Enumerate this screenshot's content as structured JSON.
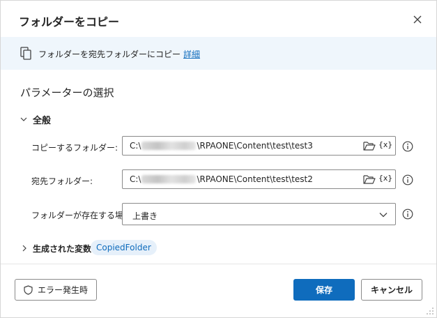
{
  "dialog": {
    "title": "フォルダーをコピー",
    "close_icon": "close-icon"
  },
  "info": {
    "icon": "copy-icon",
    "text": "フォルダーを宛先フォルダーにコピー",
    "link": "詳細"
  },
  "section": {
    "title": "パラメーターの選択"
  },
  "general": {
    "label": "全般",
    "icon": "chevron-down-icon"
  },
  "fields": {
    "source": {
      "label": "コピーするフォルダー:",
      "prefix": "C:\\",
      "suffix": "\\RPAONE\\Content\\test\\test3",
      "var_button": "{x}"
    },
    "dest": {
      "label": "宛先フォルダー:",
      "prefix": "C:\\",
      "suffix": "\\RPAONE\\Content\\test\\test2",
      "var_button": "{x}"
    },
    "if_exists": {
      "label": "フォルダーが存在する場合:",
      "value": "上書き"
    }
  },
  "vars": {
    "label": "生成された変数",
    "chip": "CopiedFolder"
  },
  "footer": {
    "error_button": "エラー発生時",
    "save_button": "保存",
    "cancel_button": "キャンセル"
  },
  "colors": {
    "accent": "#0f6cbd",
    "banner_bg": "#eff6fc",
    "chip_bg": "#e6f0fa"
  }
}
